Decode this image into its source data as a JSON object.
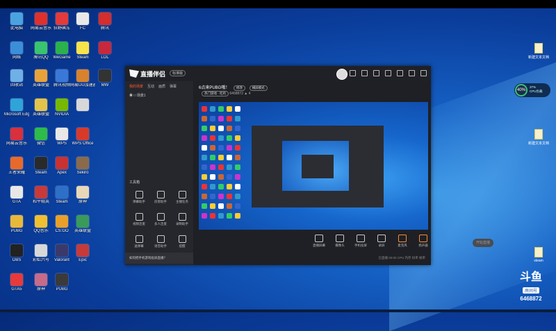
{
  "desktop": {
    "icons": [
      {
        "label": "此电脑",
        "color": "#4aa3df"
      },
      {
        "label": "网易云音乐",
        "color": "#e0302c"
      },
      {
        "label": "狂野飙车",
        "color": "#e33b3b"
      },
      {
        "label": "FC",
        "color": "#e8e8e8"
      },
      {
        "label": "腾讯",
        "color": "#d62d2d"
      },
      {
        "label": "网络",
        "color": "#3a8fd8"
      },
      {
        "label": "腾讯QQ",
        "color": "#39c46e"
      },
      {
        "label": "WeGame",
        "color": "#2bb24c"
      },
      {
        "label": "Steam",
        "color": "#f7e34a"
      },
      {
        "label": "LOL",
        "color": "#c8283b"
      },
      {
        "label": "回收站",
        "color": "#6fb0e6"
      },
      {
        "label": "英雄联盟",
        "color": "#e8a23a"
      },
      {
        "label": "腾讯视频",
        "color": "#3a78d8"
      },
      {
        "label": "网易UU加速器",
        "color": "#d8822d"
      },
      {
        "label": "MW",
        "color": "#333333"
      },
      {
        "label": "Microsoft Edge",
        "color": "#2fa4d8"
      },
      {
        "label": "英雄联盟",
        "color": "#e3c34a"
      },
      {
        "label": "NVIDIA",
        "color": "#76b900"
      },
      {
        "label": "",
        "color": "#d8d8d8"
      },
      {
        "label": "网易云音乐",
        "color": "#d8303c"
      },
      {
        "label": "微信",
        "color": "#2dbb4a"
      },
      {
        "label": "WPS",
        "color": "#e8e8e8"
      },
      {
        "label": "WPS Office",
        "color": "#d83a2a"
      },
      {
        "label": "王者荣耀",
        "color": "#e86a2a"
      },
      {
        "label": "Steam",
        "color": "#2a2a2a"
      },
      {
        "label": "Apex",
        "color": "#c83232"
      },
      {
        "label": "Sekiro",
        "color": "#8a6a4a"
      },
      {
        "label": "GTA",
        "color": "#e8e8e8"
      },
      {
        "label": "和平精英",
        "color": "#c83a3a"
      },
      {
        "label": "Steam",
        "color": "#2e6fc8"
      },
      {
        "label": "原神",
        "color": "#e8d8b8"
      },
      {
        "label": "PUBG",
        "color": "#e8b83a"
      },
      {
        "label": "QQ音乐",
        "color": "#f0c030"
      },
      {
        "label": "CS:GO",
        "color": "#e8a02a"
      },
      {
        "label": "英雄联盟",
        "color": "#3a9a5a"
      },
      {
        "label": "OBS",
        "color": "#222222"
      },
      {
        "label": "彩虹六号",
        "color": "#d8d8d8"
      },
      {
        "label": "Valorant",
        "color": "#3a3a6a"
      },
      {
        "label": "Epic",
        "color": "#c83a3a"
      },
      {
        "label": "GTA5",
        "color": "#e83a3a"
      },
      {
        "label": "原神",
        "color": "#c86a8a"
      },
      {
        "label": "PUBG",
        "color": "#3a3a3a"
      }
    ],
    "right_files": [
      {
        "label": "新建文本文档"
      },
      {
        "label": "新建文本文档"
      },
      {
        "label": "steam"
      }
    ],
    "cpu_monitor": {
      "percent": "40%",
      "line1": "37%",
      "line2": "CPU负载"
    }
  },
  "app": {
    "title": "直播伴侣",
    "version": "标准版",
    "left_tabs": [
      "我的场景",
      "互动",
      "画质",
      "弹幕"
    ],
    "active_tab_index": 0,
    "scene_label": "场景1",
    "tools_title": "工具箱",
    "tools": [
      [
        "弹幕助手",
        "房管助手",
        "主播任务"
      ],
      [
        "视频连麦",
        "多人连麦",
        "录制助手"
      ],
      [
        "送弹幕",
        "语音助手",
        "提醒"
      ]
    ],
    "notice": "如何把手机游戏投屏直播？",
    "room_title": "6点来PUBG哦！",
    "room_pill": "修改",
    "room_mode": "横屏模式",
    "room_category": "热门游戏 · 吃鸡",
    "room_no": "6468872",
    "viewer_count": "4",
    "bottom_buttons": [
      "直播屏幕",
      "摄像头",
      "手机投屏",
      "录屏",
      "麦克风",
      "扬声器"
    ],
    "start_button": "开始直播",
    "status_text": "已直播 00:00  CPU  内存  码率  帧率"
  },
  "watermark": {
    "logo": "斗鱼",
    "sub": "房间号",
    "room": "6468872"
  }
}
